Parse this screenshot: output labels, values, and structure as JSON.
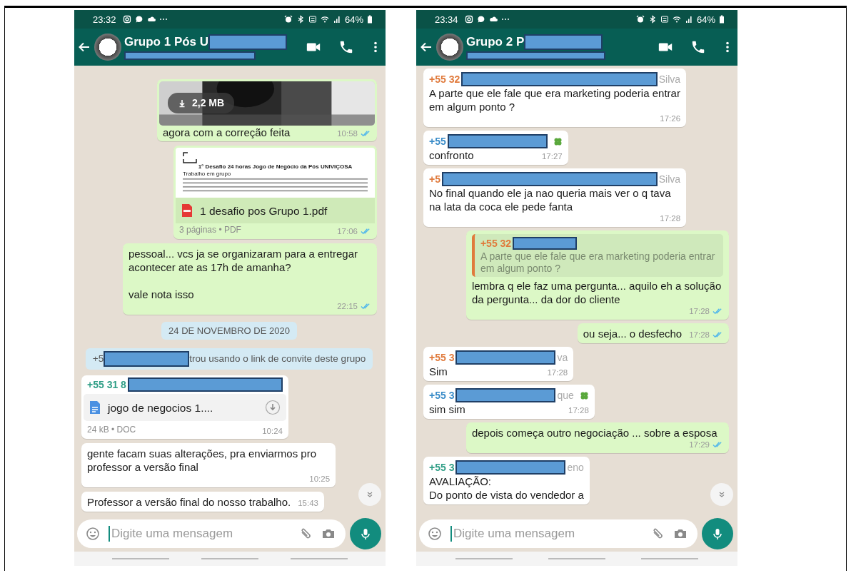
{
  "phones": [
    {
      "status_bar": {
        "time": "23:32",
        "battery": "64%"
      },
      "header": {
        "title": "Grupo 1 Pós U",
        "title_redacted": true,
        "subtitle_redacted": true
      },
      "messages": [
        {
          "outgoing": true,
          "size": "2,2 MB",
          "text": "agora com a correção feita",
          "time": "10:58",
          "read": true
        },
        {
          "kind": "pdf",
          "outgoing": true,
          "preview_heading": "1° Desafio 24 horas Jogo de Negócio da Pós UNIVIÇOSA",
          "preview_subheading": "Trabalho em grupo",
          "file": "1 desafio pos  Grupo 1.pdf",
          "meta": "3 páginas • PDF",
          "time": "17:06",
          "read": true
        },
        {
          "kind": "text",
          "outgoing": true,
          "text": "pessoal... vcs ja se organizaram para a entregar acontecer ate as 17h de amanha?\n\nvale nota isso",
          "time": "22:15",
          "read": true
        },
        {
          "kind": "date",
          "text": "24 DE NOVEMBRO DE 2020"
        },
        {
          "kind": "system",
          "prefix": "+5",
          "redacted": true,
          "text": "trou usando o link de convite deste grupo"
        },
        {
          "kind": "doc",
          "outgoing": false,
          "sender": {
            "prefix": "+55 31 8",
            "redacted": true,
            "color": "#2f9e86"
          },
          "file": "jogo de negocios 1....",
          "meta": "24 kB • DOC",
          "time": "10:24"
        },
        {
          "kind": "text",
          "outgoing": false,
          "text": "gente facam suas alterações, pra enviarmos pro professor a versão final",
          "time": "10:25"
        },
        {
          "kind": "text",
          "outgoing": false,
          "text": "Professor a versão final do nosso trabalho.",
          "time": "15:43"
        }
      ],
      "input": {
        "placeholder": "Digite uma mensagem"
      }
    },
    {
      "status_bar": {
        "time": "23:34",
        "battery": "64%"
      },
      "header": {
        "title": "Grupo 2 P",
        "title_redacted": true,
        "subtitle_redacted": true
      },
      "messages": [
        {
          "kind": "text",
          "outgoing": false,
          "sender": {
            "prefix": "+55 32",
            "redacted": true,
            "suffix": "Silva",
            "color": "#e07a3c"
          },
          "text": "A parte que ele fale que era marketing poderia entrar em algum ponto ?",
          "time": "17:26"
        },
        {
          "kind": "text",
          "outgoing": false,
          "sender": {
            "prefix": "+55",
            "redacted": true,
            "clover": true,
            "color": "#3a8cc8"
          },
          "text": "confronto",
          "time": "17:27"
        },
        {
          "kind": "text",
          "outgoing": false,
          "sender": {
            "prefix": "+5",
            "redacted": true,
            "suffix": "Silva",
            "color": "#e07a3c"
          },
          "text": "No final quando ele ja nao queria mais ver o q tava na lata da coca ele pede fanta",
          "time": "17:28"
        },
        {
          "kind": "text",
          "outgoing": true,
          "quote": {
            "prefix": "+55 32",
            "redacted": true,
            "color": "#e07a3c",
            "text": "A parte que ele fale que era marketing poderia entrar em algum ponto ?"
          },
          "text": "lembra q ele faz uma pergunta... aquilo eh a solução da pergunta... da dor do cliente",
          "time": "17:28",
          "read": true
        },
        {
          "kind": "text",
          "outgoing": true,
          "text": "ou seja... o desfecho",
          "time": "17:28",
          "read": true
        },
        {
          "kind": "text",
          "outgoing": false,
          "sender": {
            "prefix": "+55 3",
            "redacted": true,
            "suffix": "va",
            "color": "#e07a3c"
          },
          "text": "Sim",
          "time": "17:28"
        },
        {
          "kind": "text",
          "outgoing": false,
          "sender": {
            "prefix": "+55 3",
            "redacted": true,
            "suffix": "que",
            "clover": true,
            "color": "#3a8cc8"
          },
          "text": "sim sim",
          "time": "17:28"
        },
        {
          "kind": "text",
          "outgoing": true,
          "text": "depois começa outro negociação ... sobre a esposa",
          "time": "17:29",
          "read": true
        },
        {
          "kind": "text",
          "outgoing": false,
          "sender": {
            "prefix": "+55 3",
            "redacted": true,
            "suffix": "eno",
            "color": "#2f9e86"
          },
          "text": "AVALIAÇÃO:\nDo ponto de vista do vendedor a"
        }
      ],
      "input": {
        "placeholder": "Digite uma mensagem"
      }
    }
  ]
}
